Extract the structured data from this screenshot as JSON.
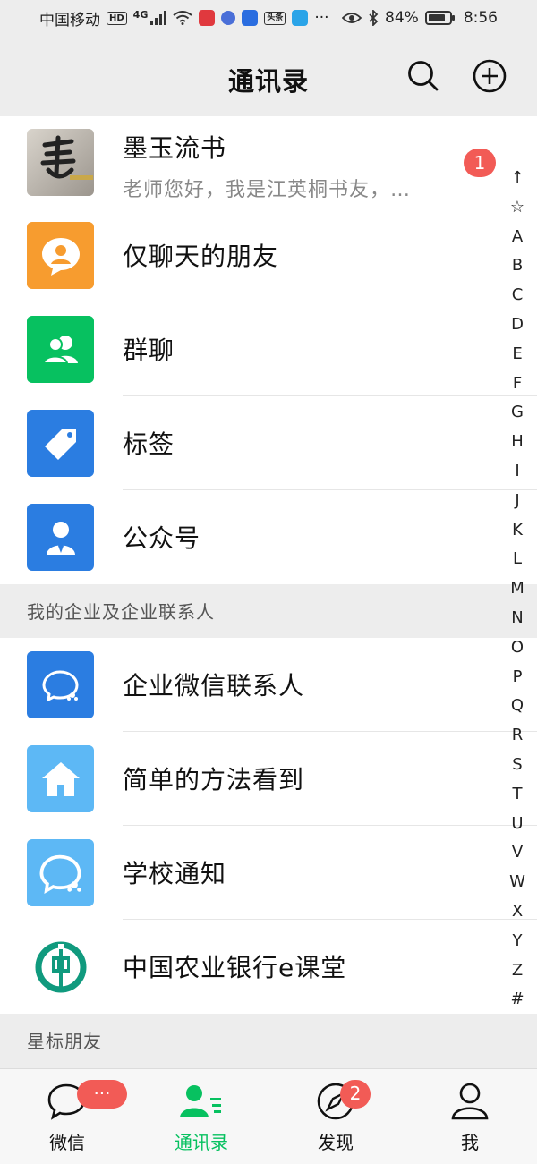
{
  "status_bar": {
    "carrier": "中国移动",
    "hd": "HD",
    "network": "4G",
    "app_badge": "头条",
    "more": "···",
    "battery": "84%",
    "battery_level": 0.84,
    "time": "8:56"
  },
  "header": {
    "title": "通讯录"
  },
  "contacts": {
    "top": {
      "name": "墨玉流书",
      "message": "老师您好，我是江英桐书友，…",
      "unread": "1"
    },
    "fixed": [
      {
        "label": "仅聊天的朋友",
        "icon": "person-bubble-icon",
        "color": "#f79c2f"
      },
      {
        "label": "群聊",
        "icon": "group-icon",
        "color": "#07c160"
      },
      {
        "label": "标签",
        "icon": "tag-icon",
        "color": "#2b7de1"
      },
      {
        "label": "公众号",
        "icon": "official-account-icon",
        "color": "#2b7de1"
      }
    ],
    "enterprise_header": "我的企业及企业联系人",
    "enterprise": [
      {
        "label": "企业微信联系人",
        "icon": "work-wechat-icon",
        "color": "#2b7de1"
      },
      {
        "label": "简单的方法看到",
        "icon": "home-icon",
        "color": "#5db8f5"
      },
      {
        "label": "学校通知",
        "icon": "work-wechat-icon",
        "color": "#5db8f5"
      },
      {
        "label": "中国农业银行e课堂",
        "icon": "abc-bank-logo-icon",
        "color": "#109a7e"
      }
    ],
    "starred_header": "星标朋友"
  },
  "index": [
    "↑",
    "☆",
    "A",
    "B",
    "C",
    "D",
    "E",
    "F",
    "G",
    "H",
    "I",
    "J",
    "K",
    "L",
    "M",
    "N",
    "O",
    "P",
    "Q",
    "R",
    "S",
    "T",
    "U",
    "V",
    "W",
    "X",
    "Y",
    "Z",
    "#"
  ],
  "tabs": [
    {
      "label": "微信",
      "badge": "···"
    },
    {
      "label": "通讯录",
      "badge": ""
    },
    {
      "label": "发现",
      "badge": "2"
    },
    {
      "label": "我",
      "badge": ""
    }
  ],
  "colors": {
    "accent": "#07c160",
    "badge": "#f25b56",
    "background": "#ededed"
  }
}
